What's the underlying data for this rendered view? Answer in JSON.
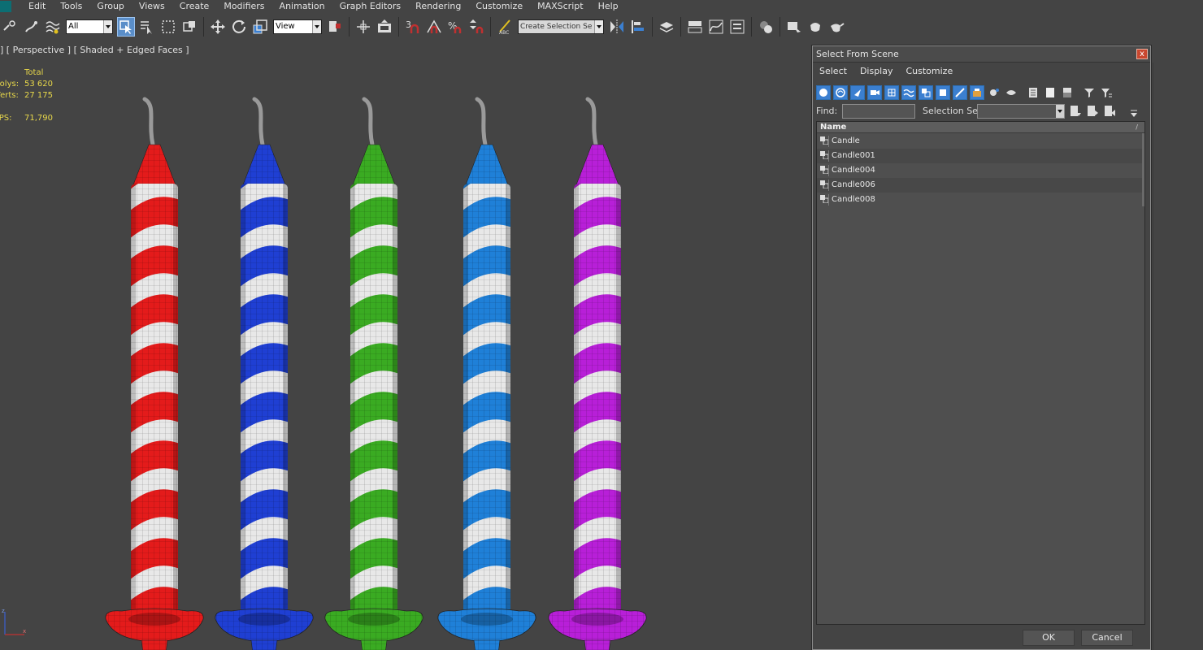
{
  "menu": [
    "Edit",
    "Tools",
    "Group",
    "Views",
    "Create",
    "Modifiers",
    "Animation",
    "Graph Editors",
    "Rendering",
    "Customize",
    "MAXScript",
    "Help"
  ],
  "toolbar": {
    "filter_value": "All",
    "ref_coord_value": "View",
    "selection_set_placeholder": "Create Selection Se"
  },
  "viewport": {
    "label": "] [ Perspective ] [ Shaded + Edged Faces ]",
    "stats": {
      "header": "Total",
      "rows": [
        {
          "label": "Polys:",
          "value": "53 620"
        },
        {
          "label": "Verts:",
          "value": "27 175"
        },
        {
          "label": "FPS:",
          "value": "71,790"
        }
      ]
    },
    "candle_colors": [
      "#e41b1b",
      "#1f3fd3",
      "#3aab22",
      "#1f80d8",
      "#b81fd8"
    ]
  },
  "dialog": {
    "title": "Select From Scene",
    "close_glyph": "x",
    "menu": [
      "Select",
      "Display",
      "Customize"
    ],
    "find_label": "Find:",
    "find_value": "",
    "selection_set_label": "Selection Set:",
    "column_name": "Name",
    "column_sort_glyph": "/",
    "items": [
      "Candle",
      "Candle001",
      "Candle004",
      "Candle006",
      "Candle008"
    ],
    "ok_label": "OK",
    "cancel_label": "Cancel"
  },
  "colors": {
    "background": "#444444",
    "stats_text": "#e8d84a",
    "selected_icon": "#3b7fd0"
  }
}
